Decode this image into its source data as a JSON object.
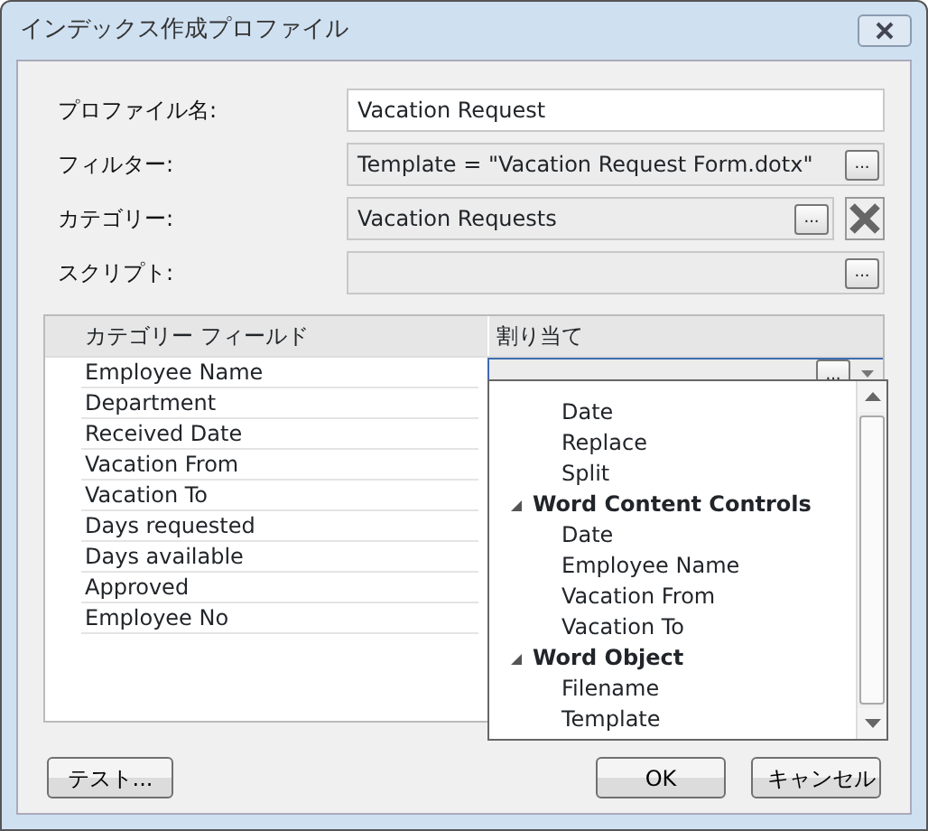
{
  "window": {
    "title": "インデックス作成プロファイル"
  },
  "fields": [
    {
      "kind": "text",
      "label": "プロファイル名:",
      "value": "Vacation Request"
    },
    {
      "kind": "browse",
      "label": "フィルター:",
      "value": "Template = \"Vacation Request Form.dotx\"",
      "button": "..."
    },
    {
      "kind": "browse_clear",
      "label": "カテゴリー:",
      "value": "Vacation Requests",
      "button": "..."
    },
    {
      "kind": "browse",
      "label": "スクリプト:",
      "button": "..."
    }
  ],
  "grid": {
    "columns": [
      "カテゴリー フィールド",
      "割り当て"
    ],
    "rows": [
      {
        "name": "Employee Name",
        "selected": true
      },
      {
        "name": "Department",
        "selected": false
      },
      {
        "name": "Received Date",
        "selected": false
      },
      {
        "name": "Vacation From",
        "selected": false
      },
      {
        "name": "Vacation To",
        "selected": false
      },
      {
        "name": "Days requested",
        "selected": false
      },
      {
        "name": "Days available",
        "selected": false
      },
      {
        "name": "Approved",
        "selected": false
      },
      {
        "name": "Employee No",
        "selected": false
      }
    ],
    "editor_button": "...",
    "dropdown": {
      "items": [
        {
          "label": "Date"
        },
        {
          "label": "Replace"
        },
        {
          "label": "Split"
        },
        {
          "label": "Word Content Controls",
          "expanded": true,
          "children": [
            {
              "label": "Date"
            },
            {
              "label": "Employee Name"
            },
            {
              "label": "Vacation From"
            },
            {
              "label": "Vacation To"
            }
          ]
        },
        {
          "label": "Word Object",
          "expanded": true,
          "children": [
            {
              "label": "Filename"
            },
            {
              "label": "Template"
            }
          ]
        }
      ]
    }
  },
  "buttons": [
    {
      "kind": "test",
      "label": "テスト..."
    },
    {
      "kind": "ok",
      "label": "OK"
    },
    {
      "kind": "cancel",
      "label": "キャンセル"
    }
  ]
}
